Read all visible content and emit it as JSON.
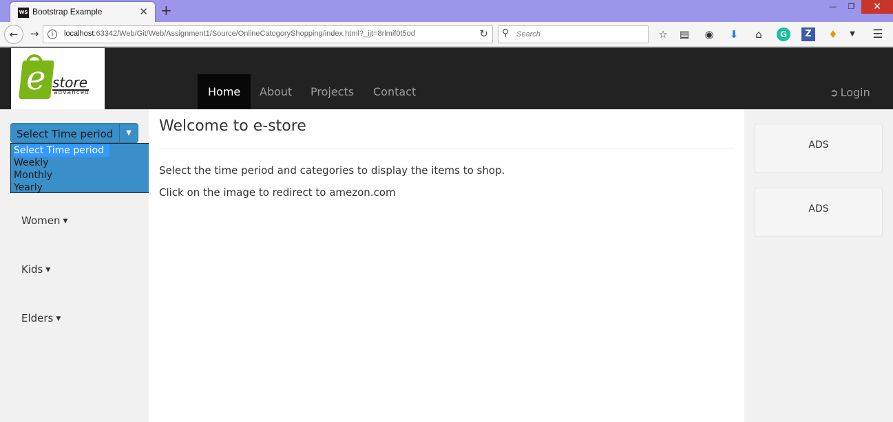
{
  "browser": {
    "tab_title": "Bootstrap Example",
    "tab_favicon_text": "WS",
    "url_host": "localhost",
    "url_rest": ":63342/Web/Git/Web/Assignment1/Source/OnlineCatogoryShopping/index.html?_ijt=8rlmif0t5od",
    "search_placeholder": "Search"
  },
  "header": {
    "logo_e": "e",
    "logo_store": "store",
    "logo_advanced": "advanced",
    "nav": [
      {
        "label": "Home",
        "active": true
      },
      {
        "label": "About"
      },
      {
        "label": "Projects"
      },
      {
        "label": "Contact"
      }
    ],
    "login_label": "Login"
  },
  "sidebar": {
    "time_select_label": "Select Time period",
    "time_options": [
      "Select Time period",
      "Weekly",
      "Monthly",
      "Yearly"
    ],
    "categories": [
      "Women",
      "Kids",
      "Elders"
    ]
  },
  "main": {
    "title": "Welcome to e-store",
    "para1": "Select the time period and categories to display the items to shop.",
    "para2": "Click on the image to redirect to amezon.com"
  },
  "ads": [
    "ADS",
    "ADS"
  ],
  "colors": {
    "accent_blue": "#3a8fc9",
    "navbar_bg": "#222222",
    "logo_green": "#7cb518"
  }
}
